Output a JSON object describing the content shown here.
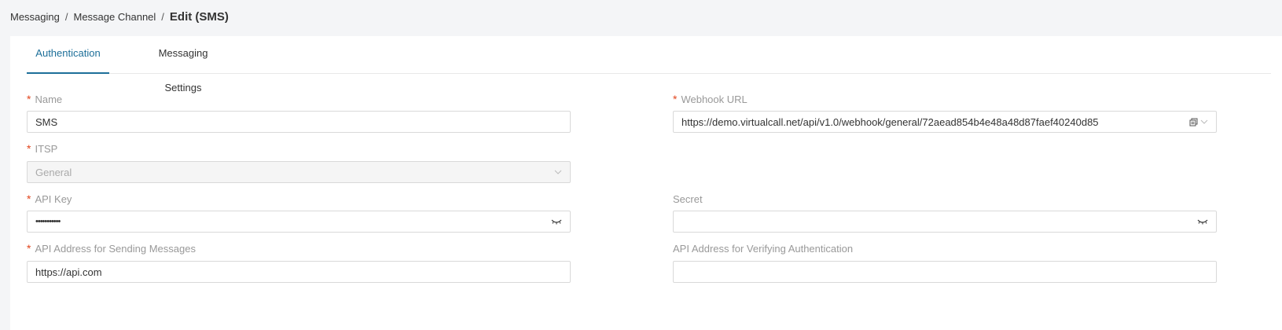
{
  "breadcrumb": {
    "items": [
      "Messaging",
      "Message Channel"
    ],
    "current": "Edit (SMS)"
  },
  "tabs": [
    {
      "label": "Authentication",
      "active": true
    },
    {
      "label": "Messaging Settings",
      "active": false
    }
  ],
  "form": {
    "name": {
      "label": "Name",
      "required": true,
      "value": "SMS"
    },
    "webhook_url": {
      "label": "Webhook URL",
      "required": true,
      "value": "https://demo.virtualcall.net/api/v1.0/webhook/general/72aead854b4e48a48d87faef40240d85"
    },
    "itsp": {
      "label": "ITSP",
      "required": true,
      "value": "General"
    },
    "api_key": {
      "label": "API Key",
      "required": true,
      "value": "•••••••••••"
    },
    "secret": {
      "label": "Secret",
      "required": false,
      "value": ""
    },
    "api_send": {
      "label": "API Address for Sending Messages",
      "required": true,
      "value": "https://api.com"
    },
    "api_verify": {
      "label": "API Address for Verifying Authentication",
      "required": false,
      "value": ""
    }
  },
  "colors": {
    "accent": "#1d6f99",
    "required": "#e2451d"
  }
}
